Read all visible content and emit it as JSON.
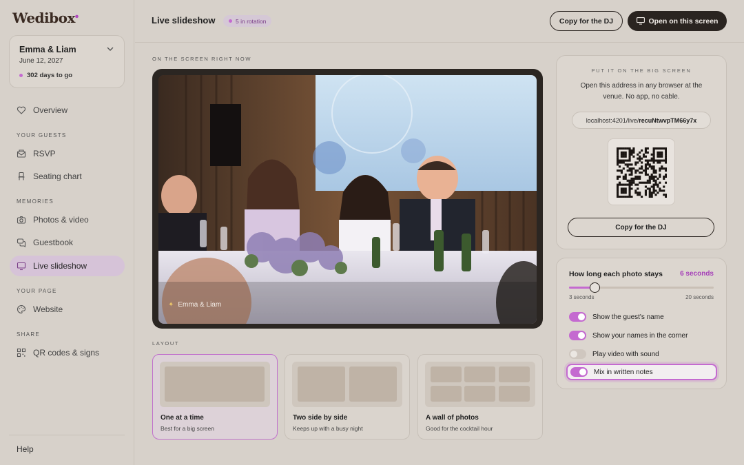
{
  "app": {
    "logo": "Wedibox"
  },
  "couple": {
    "names": "Emma & Liam",
    "date": "June 12, 2027",
    "countdown": "302 days to go"
  },
  "sidebar": {
    "overview": "Overview",
    "sections": [
      {
        "heading": "YOUR GUESTS",
        "items": [
          "RSVP",
          "Seating chart"
        ]
      },
      {
        "heading": "MEMORIES",
        "items": [
          "Photos & video",
          "Guestbook",
          "Live slideshow"
        ]
      },
      {
        "heading": "YOUR PAGE",
        "items": [
          "Website"
        ]
      },
      {
        "heading": "SHARE",
        "items": [
          "QR codes & signs"
        ]
      }
    ],
    "active": "Live slideshow",
    "help": "Help"
  },
  "header": {
    "title": "Live slideshow",
    "badge": "5 in rotation",
    "copy_button": "Copy for the DJ",
    "open_button": "Open on this screen"
  },
  "preview": {
    "section_label": "ON THE SCREEN RIGHT NOW",
    "caption": "Emma & Liam"
  },
  "layout": {
    "section_label": "LAYOUT",
    "options": [
      {
        "title": "One at a time",
        "subtitle": "Best for a big screen",
        "selected": true
      },
      {
        "title": "Two side by side",
        "subtitle": "Keeps up with a busy night",
        "selected": false
      },
      {
        "title": "A wall of photos",
        "subtitle": "Good for the cocktail hour",
        "selected": false
      }
    ]
  },
  "big_screen": {
    "heading": "PUT IT ON THE BIG SCREEN",
    "description": "Open this address in any browser at the venue. No app, no cable.",
    "url_prefix": "localhost:4201/live/",
    "url_id": "recuNtwvpTM66y7x",
    "copy_button": "Copy for the DJ"
  },
  "settings": {
    "duration_label": "How long each photo stays",
    "duration_value": "6 seconds",
    "duration_seconds": 6,
    "min_label": "3 seconds",
    "max_label": "20 seconds",
    "min": 3,
    "max": 20,
    "toggles": [
      {
        "label": "Show the guest's name",
        "on": true
      },
      {
        "label": "Show your names in the corner",
        "on": true
      },
      {
        "label": "Play video with sound",
        "on": false
      },
      {
        "label": "Mix in written notes",
        "on": true,
        "focused": true
      }
    ]
  },
  "colors": {
    "accent": "#c46ad0",
    "dark": "#2a2420",
    "background": "#d7d1ca"
  }
}
